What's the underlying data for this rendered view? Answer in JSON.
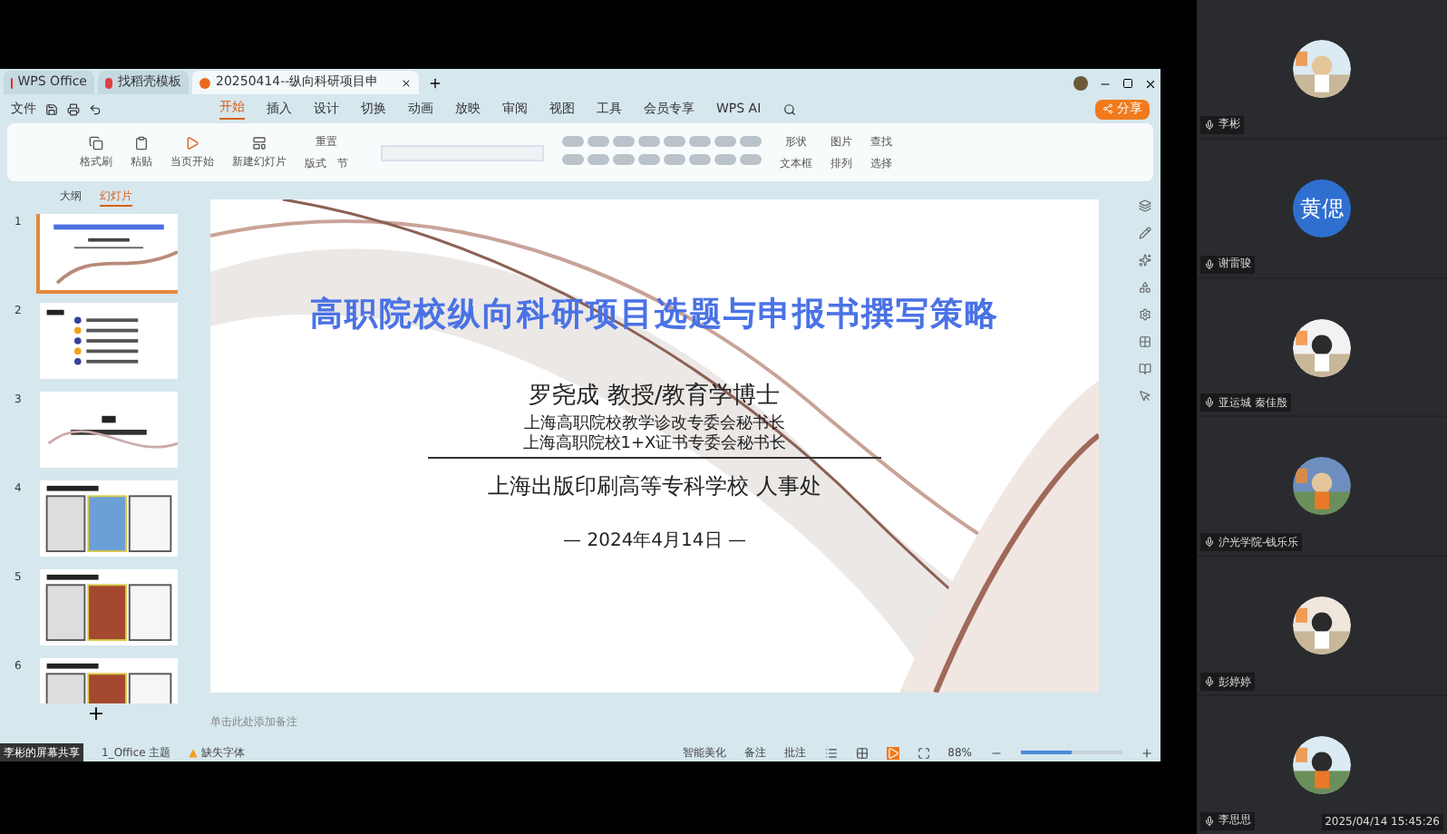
{
  "doc_tabs": [
    {
      "label": "WPS Office",
      "kind": "home",
      "selected": false
    },
    {
      "label": "找稻壳模板",
      "kind": "template",
      "selected": false
    },
    {
      "label": "20250414--纵向科研项目申",
      "kind": "ppt",
      "selected": true
    }
  ],
  "menu": {
    "file": "文件",
    "tabs": [
      {
        "label": "开始",
        "selected": true
      },
      {
        "label": "插入",
        "selected": false
      },
      {
        "label": "设计",
        "selected": false
      },
      {
        "label": "切换",
        "selected": false
      },
      {
        "label": "动画",
        "selected": false
      },
      {
        "label": "放映",
        "selected": false
      },
      {
        "label": "审阅",
        "selected": false
      },
      {
        "label": "视图",
        "selected": false
      },
      {
        "label": "工具",
        "selected": false
      },
      {
        "label": "会员专享",
        "selected": false
      },
      {
        "label": "WPS AI",
        "selected": false
      }
    ],
    "share": "分享"
  },
  "ribbon": {
    "left": [
      {
        "label": "格式刷"
      },
      {
        "label": "粘贴"
      },
      {
        "label": "当页开始"
      },
      {
        "label": "新建幻灯片"
      }
    ],
    "layout": "版式",
    "reset": "重置",
    "section": "节",
    "right": [
      {
        "label": "形状"
      },
      {
        "label": "文本框"
      },
      {
        "label": "图片"
      },
      {
        "label": "排列"
      },
      {
        "label": "查找"
      },
      {
        "label": "选择"
      }
    ]
  },
  "panel": {
    "tabs": [
      {
        "label": "大纲",
        "selected": false
      },
      {
        "label": "幻灯片",
        "selected": true
      }
    ],
    "slides": [
      {
        "number": "1",
        "kind": "title",
        "selected": true
      },
      {
        "number": "2",
        "kind": "list",
        "selected": false
      },
      {
        "number": "3",
        "kind": "section",
        "selected": false
      },
      {
        "number": "4",
        "kind": "docs",
        "selected": false
      },
      {
        "number": "5",
        "kind": "docs",
        "selected": false
      },
      {
        "number": "6",
        "kind": "docs",
        "selected": false
      }
    ],
    "add": "+"
  },
  "slide": {
    "title": "高职院校纵向科研项目选题与申报书撰写策略",
    "author": "罗尧成  教授/教育学博士",
    "roles": [
      "上海高职院校教学诊改专委会秘书长",
      "上海高职院校1+X证书专委会秘书长"
    ],
    "org": "上海出版印刷高等专科学校  人事处",
    "date": "— 2024年4月14日 —"
  },
  "notes": {
    "placeholder": "单击此处添加备注"
  },
  "status": {
    "sharer": "李彬的屏幕共享",
    "theme": "1_Office 主题",
    "missing_font": "缺失字体",
    "warning_mark": "▲",
    "beautify": "智能美化",
    "notes": "备注",
    "comments": "批注",
    "zoom": "88%"
  },
  "zoom_slider": {
    "level": 0.5
  },
  "participants": [
    {
      "name": "李彬",
      "kind": "picture"
    },
    {
      "name": "谢雷骏",
      "kind": "text",
      "initials": "黄偲"
    },
    {
      "name": "亚运城 秦佳殷",
      "kind": "picture"
    },
    {
      "name": "沪光学院-钱乐乐",
      "kind": "picture"
    },
    {
      "name": "彭婷婷",
      "kind": "picture"
    },
    {
      "name": "李思思",
      "kind": "picture"
    }
  ],
  "timestamp": "2025/04/14 15:45:26"
}
